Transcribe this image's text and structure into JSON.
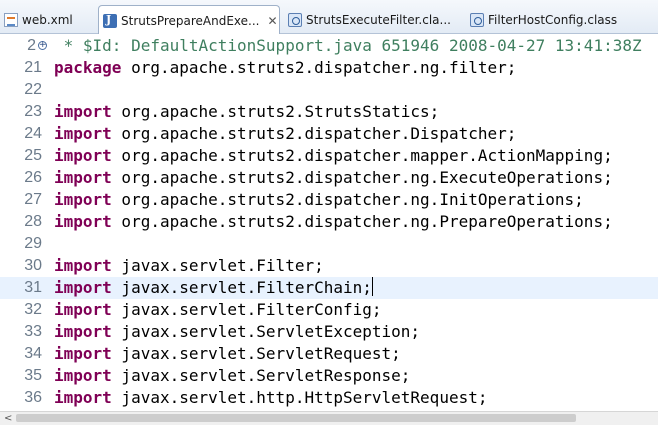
{
  "tabs": [
    {
      "label": "web.xml",
      "icon": "xml-file-icon"
    },
    {
      "label": "StrutsPrepareAndExe...",
      "icon": "java-file-icon",
      "active": true,
      "close": "✕"
    },
    {
      "label": "StrutsExecuteFilter.cla...",
      "icon": "class-file-icon"
    },
    {
      "label": "FilterHostConfig.class",
      "icon": "class-file-icon"
    }
  ],
  "editor": {
    "lines": [
      {
        "num": "2",
        "fold": "+",
        "segments": [
          {
            "t": " * $Id: DefaultActionSupport.java 651946 2008-04-27 13:41:38Z",
            "c": "cm"
          }
        ]
      },
      {
        "num": "21",
        "segments": [
          {
            "t": "package",
            "c": "kw"
          },
          {
            "t": " org.apache.struts2.dispatcher.ng.filter;",
            "c": ""
          }
        ]
      },
      {
        "num": "22",
        "segments": []
      },
      {
        "num": "23",
        "segments": [
          {
            "t": "import",
            "c": "kw"
          },
          {
            "t": " org.apache.struts2.StrutsStatics;",
            "c": ""
          }
        ]
      },
      {
        "num": "24",
        "segments": [
          {
            "t": "import",
            "c": "kw"
          },
          {
            "t": " org.apache.struts2.dispatcher.Dispatcher;",
            "c": ""
          }
        ]
      },
      {
        "num": "25",
        "segments": [
          {
            "t": "import",
            "c": "kw"
          },
          {
            "t": " org.apache.struts2.dispatcher.mapper.ActionMapping;",
            "c": ""
          }
        ]
      },
      {
        "num": "26",
        "segments": [
          {
            "t": "import",
            "c": "kw"
          },
          {
            "t": " org.apache.struts2.dispatcher.ng.ExecuteOperations;",
            "c": ""
          }
        ]
      },
      {
        "num": "27",
        "segments": [
          {
            "t": "import",
            "c": "kw"
          },
          {
            "t": " org.apache.struts2.dispatcher.ng.InitOperations;",
            "c": ""
          }
        ]
      },
      {
        "num": "28",
        "segments": [
          {
            "t": "import",
            "c": "kw"
          },
          {
            "t": " org.apache.struts2.dispatcher.ng.PrepareOperations;",
            "c": ""
          }
        ]
      },
      {
        "num": "29",
        "segments": []
      },
      {
        "num": "30",
        "segments": [
          {
            "t": "import",
            "c": "kw"
          },
          {
            "t": " javax.servlet.Filter;",
            "c": ""
          }
        ]
      },
      {
        "num": "31",
        "current": true,
        "segments": [
          {
            "t": "import",
            "c": "kw"
          },
          {
            "t": " javax.servlet.FilterChain;",
            "c": ""
          }
        ]
      },
      {
        "num": "32",
        "segments": [
          {
            "t": "import",
            "c": "kw"
          },
          {
            "t": " javax.servlet.FilterConfig;",
            "c": ""
          }
        ]
      },
      {
        "num": "33",
        "segments": [
          {
            "t": "import",
            "c": "kw"
          },
          {
            "t": " javax.servlet.ServletException;",
            "c": ""
          }
        ]
      },
      {
        "num": "34",
        "segments": [
          {
            "t": "import",
            "c": "kw"
          },
          {
            "t": " javax.servlet.ServletRequest;",
            "c": ""
          }
        ]
      },
      {
        "num": "35",
        "segments": [
          {
            "t": "import",
            "c": "kw"
          },
          {
            "t": " javax.servlet.ServletResponse;",
            "c": ""
          }
        ]
      },
      {
        "num": "36",
        "segments": [
          {
            "t": "import",
            "c": "kw"
          },
          {
            "t": " javax.servlet.http.HttpServletRequest;",
            "c": ""
          }
        ]
      }
    ]
  },
  "scrollbar": {
    "left_arrow": "<"
  },
  "colors": {
    "keyword": "#7f0055",
    "comment": "#3f7f5f",
    "current_line": "#e8f2fe"
  }
}
